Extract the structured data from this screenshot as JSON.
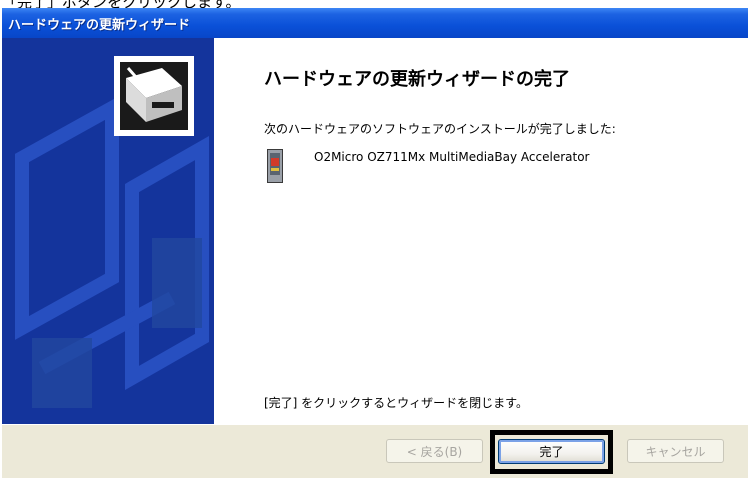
{
  "caption": {
    "text": "「完了」ボタンをクリックします。"
  },
  "window": {
    "title": "ハードウェアの更新ウィザード"
  },
  "content": {
    "heading": "ハードウェアの更新ウィザードの完了",
    "message": "次のハードウェアのソフトウェアのインストールが完了しました:",
    "device_name": "O2Micro OZ711Mx MultiMediaBay Accelerator",
    "device_icon": "pc-card-icon",
    "footer": "[完了] をクリックするとウィザードを閉じます。"
  },
  "buttons": {
    "back": "< 戻る(B)",
    "finish": "完了",
    "cancel": "キャンセル"
  },
  "colors": {
    "titlebar": "#0a50d8",
    "left_panel": "#14349c",
    "button_bar": "#ece9d8",
    "highlight": "#000000"
  }
}
